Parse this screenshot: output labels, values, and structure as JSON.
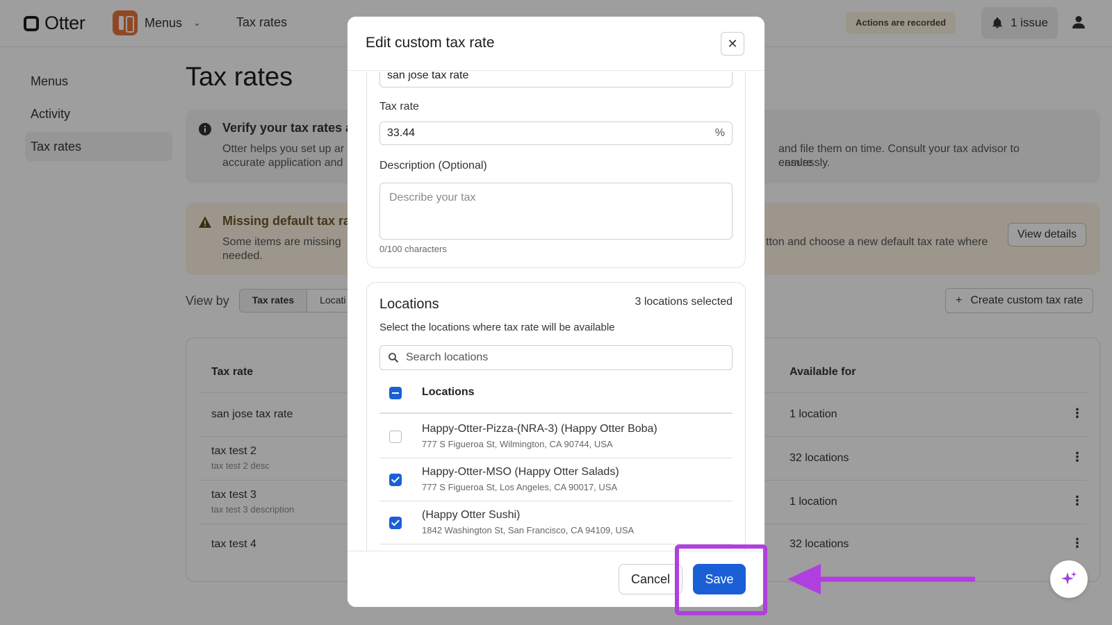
{
  "topbar": {
    "logo_text": "Otter",
    "app_name": "Menus",
    "nav_link": "Tax rates",
    "recorded_badge": "Actions are recorded",
    "issue_label": "1 issue"
  },
  "sidebar": {
    "items": [
      {
        "label": "Menus"
      },
      {
        "label": "Activity"
      },
      {
        "label": "Tax rates",
        "active": true
      }
    ]
  },
  "main": {
    "title": "Tax rates",
    "info_banner": {
      "title": "Verify your tax rates a",
      "text_left": "Otter helps you set up ar",
      "text_left2": "accurate application and",
      "text_right": "and file them on time. Consult your tax advisor to ensure",
      "text_right2": "eamlessly."
    },
    "warning_banner": {
      "title": "Missing default tax ra",
      "text_left": "Some items are missing",
      "text_left2": "needed.",
      "text_right": "tton and choose a new default tax rate where",
      "button": "View details"
    },
    "view_by": {
      "label": "View by",
      "options": [
        "Tax rates",
        "Locati"
      ],
      "selected": "Tax rates"
    },
    "create_button": "Create custom tax rate",
    "table": {
      "headers": {
        "tax_rate": "Tax rate",
        "available_for": "Available for"
      },
      "rows": [
        {
          "name": "san jose tax rate",
          "description": "",
          "available": "1 location"
        },
        {
          "name": "tax test 2",
          "description": "tax test 2 desc",
          "available": "32 locations"
        },
        {
          "name": "tax test 3",
          "description": "tax test 3 description",
          "available": "1 location"
        },
        {
          "name": "tax test 4",
          "description": "",
          "available": "32 locations"
        }
      ]
    }
  },
  "modal": {
    "title": "Edit custom tax rate",
    "name_value": "san jose tax rate",
    "tax_rate_label": "Tax rate",
    "tax_rate_value": "33.44",
    "tax_rate_suffix": "%",
    "description_label": "Description (Optional)",
    "description_placeholder": "Describe your tax",
    "char_counter": "0/100 characters",
    "locations": {
      "title": "Locations",
      "selected_count": "3 locations selected",
      "subtitle": "Select the locations where tax rate will be available",
      "search_placeholder": "Search locations",
      "header_label": "Locations",
      "items": [
        {
          "name": "Happy-Otter-Pizza-(NRA-3) (Happy Otter Boba)",
          "address": "777 S Figueroa St, Wilmington, CA 90744, USA",
          "checked": false
        },
        {
          "name": "Happy-Otter-MSO (Happy Otter Salads)",
          "address": "777 S Figueroa St, Los Angeles, CA 90017, USA",
          "checked": true
        },
        {
          "name": "(Happy Otter Sushi)",
          "address": "1842 Washington St, San Francisco, CA 94109, USA",
          "checked": true
        }
      ]
    },
    "cancel_label": "Cancel",
    "save_label": "Save"
  },
  "colors": {
    "primary": "#1a5fd6",
    "highlight": "#b03fe0",
    "overlay": "rgba(0,0,0,0.38)"
  }
}
